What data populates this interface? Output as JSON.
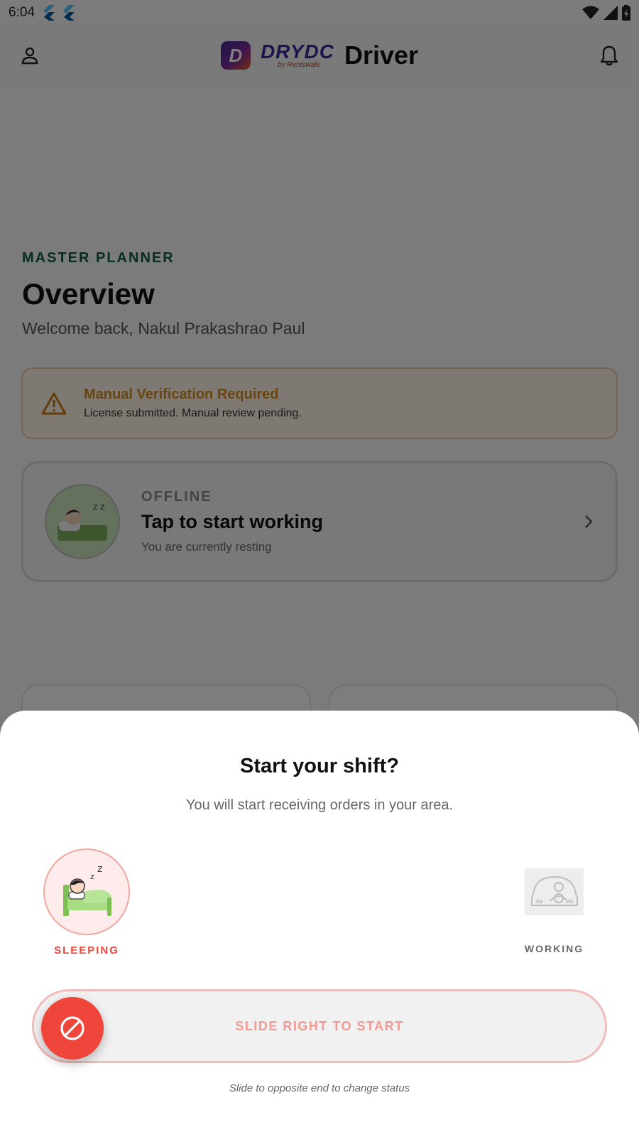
{
  "status_bar": {
    "time": "6:04"
  },
  "app_bar": {
    "logo_text": "DRYDC",
    "logo_sub": "by Rentswale",
    "title": "Driver"
  },
  "main": {
    "section_label": "MASTER PLANNER",
    "title": "Overview",
    "welcome": "Welcome back, Nakul Prakashrao Paul",
    "alert": {
      "title": "Manual Verification Required",
      "desc": "License submitted. Manual review pending."
    },
    "status_card": {
      "tag": "OFFLINE",
      "headline": "Tap to start working",
      "sub": "You are currently resting"
    }
  },
  "sheet": {
    "title": "Start your shift?",
    "subtitle": "You will start receiving orders in your area.",
    "left_label": "SLEEPING",
    "right_label": "WORKING",
    "slider_label": "SLIDE RIGHT TO START",
    "hint": "Slide to opposite end to change status"
  },
  "colors": {
    "accent_red": "#f0453a",
    "brand_green": "#0d5a3a",
    "warning": "#d58a1c"
  },
  "icons": [
    "profile-icon",
    "bell-icon",
    "warning-icon",
    "chevron-right-icon",
    "block-icon",
    "sleeping-icon",
    "driving-icon",
    "wifi-icon",
    "signal-icon",
    "battery-icon"
  ]
}
